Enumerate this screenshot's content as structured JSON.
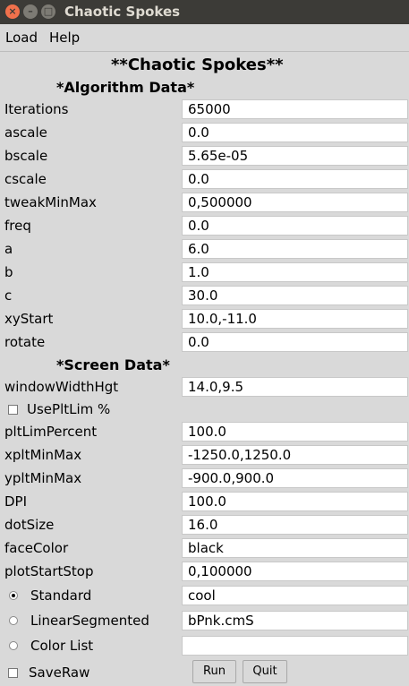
{
  "window": {
    "title": "Chaotic Spokes",
    "close_glyph": "×",
    "min_glyph": "–",
    "max_glyph": "□"
  },
  "menu": {
    "load": "Load",
    "help": "Help"
  },
  "headings": {
    "main": "**Chaotic Spokes**",
    "algorithm": "*Algorithm Data*",
    "screen": "*Screen Data*"
  },
  "algorithm": [
    {
      "label": "Iterations",
      "value": "65000"
    },
    {
      "label": "ascale",
      "value": "0.0"
    },
    {
      "label": "bscale",
      "value": "5.65e-05"
    },
    {
      "label": "cscale",
      "value": "0.0"
    },
    {
      "label": "tweakMinMax",
      "value": "0,500000"
    },
    {
      "label": "freq",
      "value": "0.0"
    },
    {
      "label": "a",
      "value": "6.0"
    },
    {
      "label": "b",
      "value": "1.0"
    },
    {
      "label": "c",
      "value": "30.0"
    },
    {
      "label": "xyStart",
      "value": "10.0,-11.0"
    },
    {
      "label": "rotate",
      "value": "0.0"
    }
  ],
  "screen": {
    "windowWidthHgt": {
      "label": "windowWidthHgt",
      "value": "14.0,9.5"
    },
    "usePltLim": {
      "label": "UsePltLim %",
      "checked": false
    },
    "fields": [
      {
        "label": "pltLimPercent",
        "value": "100.0"
      },
      {
        "label": "xpltMinMax",
        "value": "-1250.0,1250.0"
      },
      {
        "label": "ypltMinMax",
        "value": "-900.0,900.0"
      },
      {
        "label": "DPI",
        "value": "100.0"
      },
      {
        "label": "dotSize",
        "value": "16.0"
      },
      {
        "label": "faceColor",
        "value": "black"
      },
      {
        "label": "plotStartStop",
        "value": "0,100000"
      }
    ]
  },
  "colormap": {
    "selected": "Standard",
    "options": [
      {
        "label": "Standard",
        "value": "cool",
        "selected": true
      },
      {
        "label": "LinearSegmented",
        "value": "bPnk.cmS",
        "selected": false
      },
      {
        "label": "Color List",
        "value": "",
        "selected": false
      }
    ]
  },
  "bottom": {
    "saveRaw": "SaveRaw",
    "saveRaw_checked": false,
    "run": "Run",
    "quit": "Quit"
  }
}
